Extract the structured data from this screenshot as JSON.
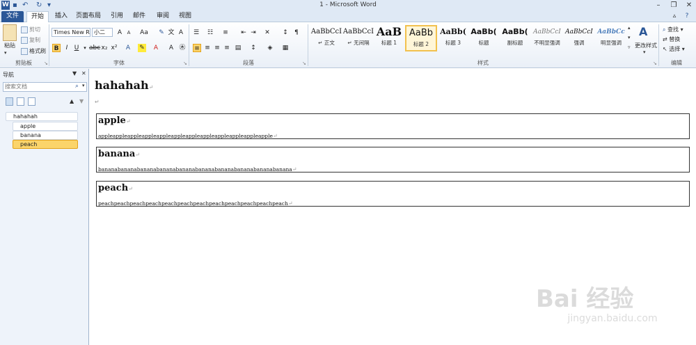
{
  "app": {
    "title": "1 - Microsoft Word"
  },
  "tabs": [
    {
      "label": "文件"
    },
    {
      "label": "开始"
    },
    {
      "label": "插入"
    },
    {
      "label": "页面布局"
    },
    {
      "label": "引用"
    },
    {
      "label": "邮件"
    },
    {
      "label": "审阅"
    },
    {
      "label": "视图"
    }
  ],
  "ribbon": {
    "clipboard": {
      "paste": "粘贴",
      "cut": "剪切",
      "copy": "复制",
      "format_painter": "格式刷",
      "label": "剪贴板"
    },
    "font": {
      "name": "Times New R",
      "size": "小二",
      "label": "字体"
    },
    "paragraph": {
      "label": "段落"
    },
    "styles": {
      "label": "样式",
      "items": [
        {
          "sample": "AaBbCcI",
          "name": "↵ 正文"
        },
        {
          "sample": "AaBbCcI",
          "name": "↵ 无间隔"
        },
        {
          "sample": "AaB",
          "name": "标题 1"
        },
        {
          "sample": "AaBb",
          "name": "标题 2"
        },
        {
          "sample": "AaBb(",
          "name": "标题 3"
        },
        {
          "sample": "AaBb(",
          "name": "标题"
        },
        {
          "sample": "AaBb(",
          "name": "副标题"
        },
        {
          "sample": "AaBbCcI",
          "name": "不明显强调"
        },
        {
          "sample": "AaBbCcI",
          "name": "强调"
        },
        {
          "sample": "AaBbCc",
          "name": "明显强调"
        }
      ],
      "change_styles": "更改样式"
    },
    "editing": {
      "find": "查找",
      "replace": "替换",
      "select": "选择",
      "label": "编辑"
    }
  },
  "nav": {
    "title": "导航",
    "search_placeholder": "搜索文档",
    "outline": [
      {
        "label": "hahahah"
      },
      {
        "label": "apple"
      },
      {
        "label": "banana"
      },
      {
        "label": "peach"
      }
    ]
  },
  "document": {
    "title": "hahahah",
    "sections": [
      {
        "heading": "apple",
        "body": "appleappleappleappleappleappleappleappleappleappleappleapple"
      },
      {
        "heading": "banana",
        "body": "bananabananabananabananabananabananabananabananabananabanana"
      },
      {
        "heading": "peach",
        "body": "peachpeachpeachpeachpeachpeachpeachpeachpeachpeachpeachpeach"
      }
    ]
  },
  "watermark": {
    "brand": "Bai 经验",
    "url": "jingyan.baidu.com"
  }
}
